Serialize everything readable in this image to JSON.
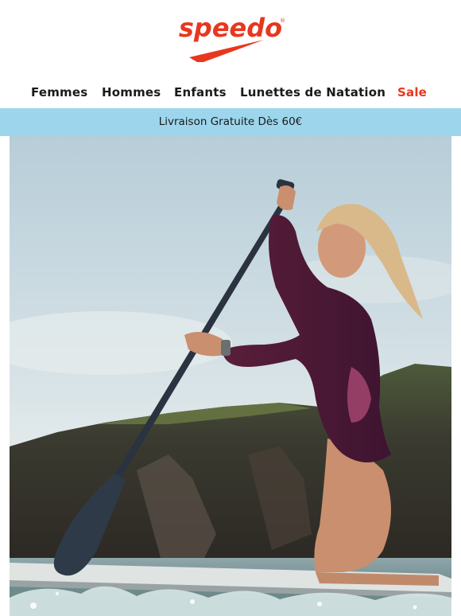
{
  "brand": {
    "name": "speedo",
    "accent_color": "#e8371f"
  },
  "nav": {
    "items": [
      {
        "label": "Femmes"
      },
      {
        "label": "Hommes"
      },
      {
        "label": "Enfants"
      },
      {
        "label": "Lunettes de Natation"
      },
      {
        "label": "Sale"
      }
    ]
  },
  "banner": {
    "text": "Livraison Gratuite Dès 60€",
    "color": "#9dd6ec"
  },
  "hero": {
    "icon": "paddleboarder-photo"
  }
}
